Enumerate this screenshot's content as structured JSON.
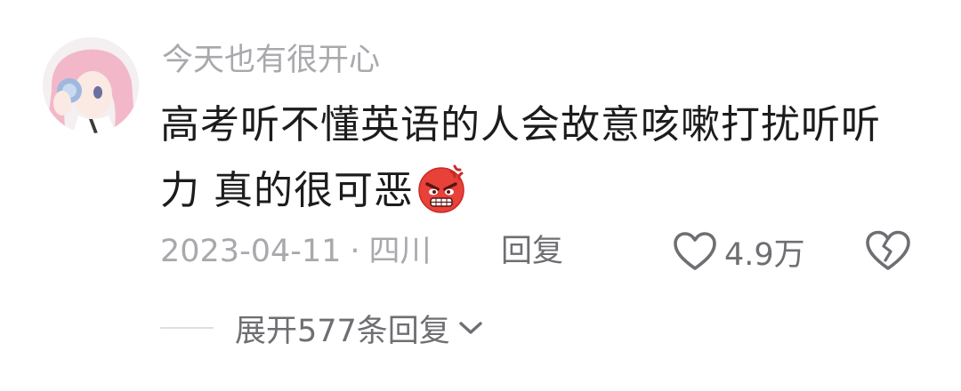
{
  "comment": {
    "username": "今天也有很开心",
    "text": "高考听不懂英语的人会故意咳嗽打扰听听力 真的很可恶",
    "emoji_icon": "angry-face-icon",
    "date": "2023-04-11",
    "separator": "·",
    "location": "四川",
    "reply_label": "回复",
    "like_count": "4.9万",
    "expand_label": "展开577条回复"
  },
  "colors": {
    "username": "#a9a9ad",
    "text": "#1c1c1e",
    "secondary": "#6e6e73",
    "emoji": "#e8413a"
  }
}
